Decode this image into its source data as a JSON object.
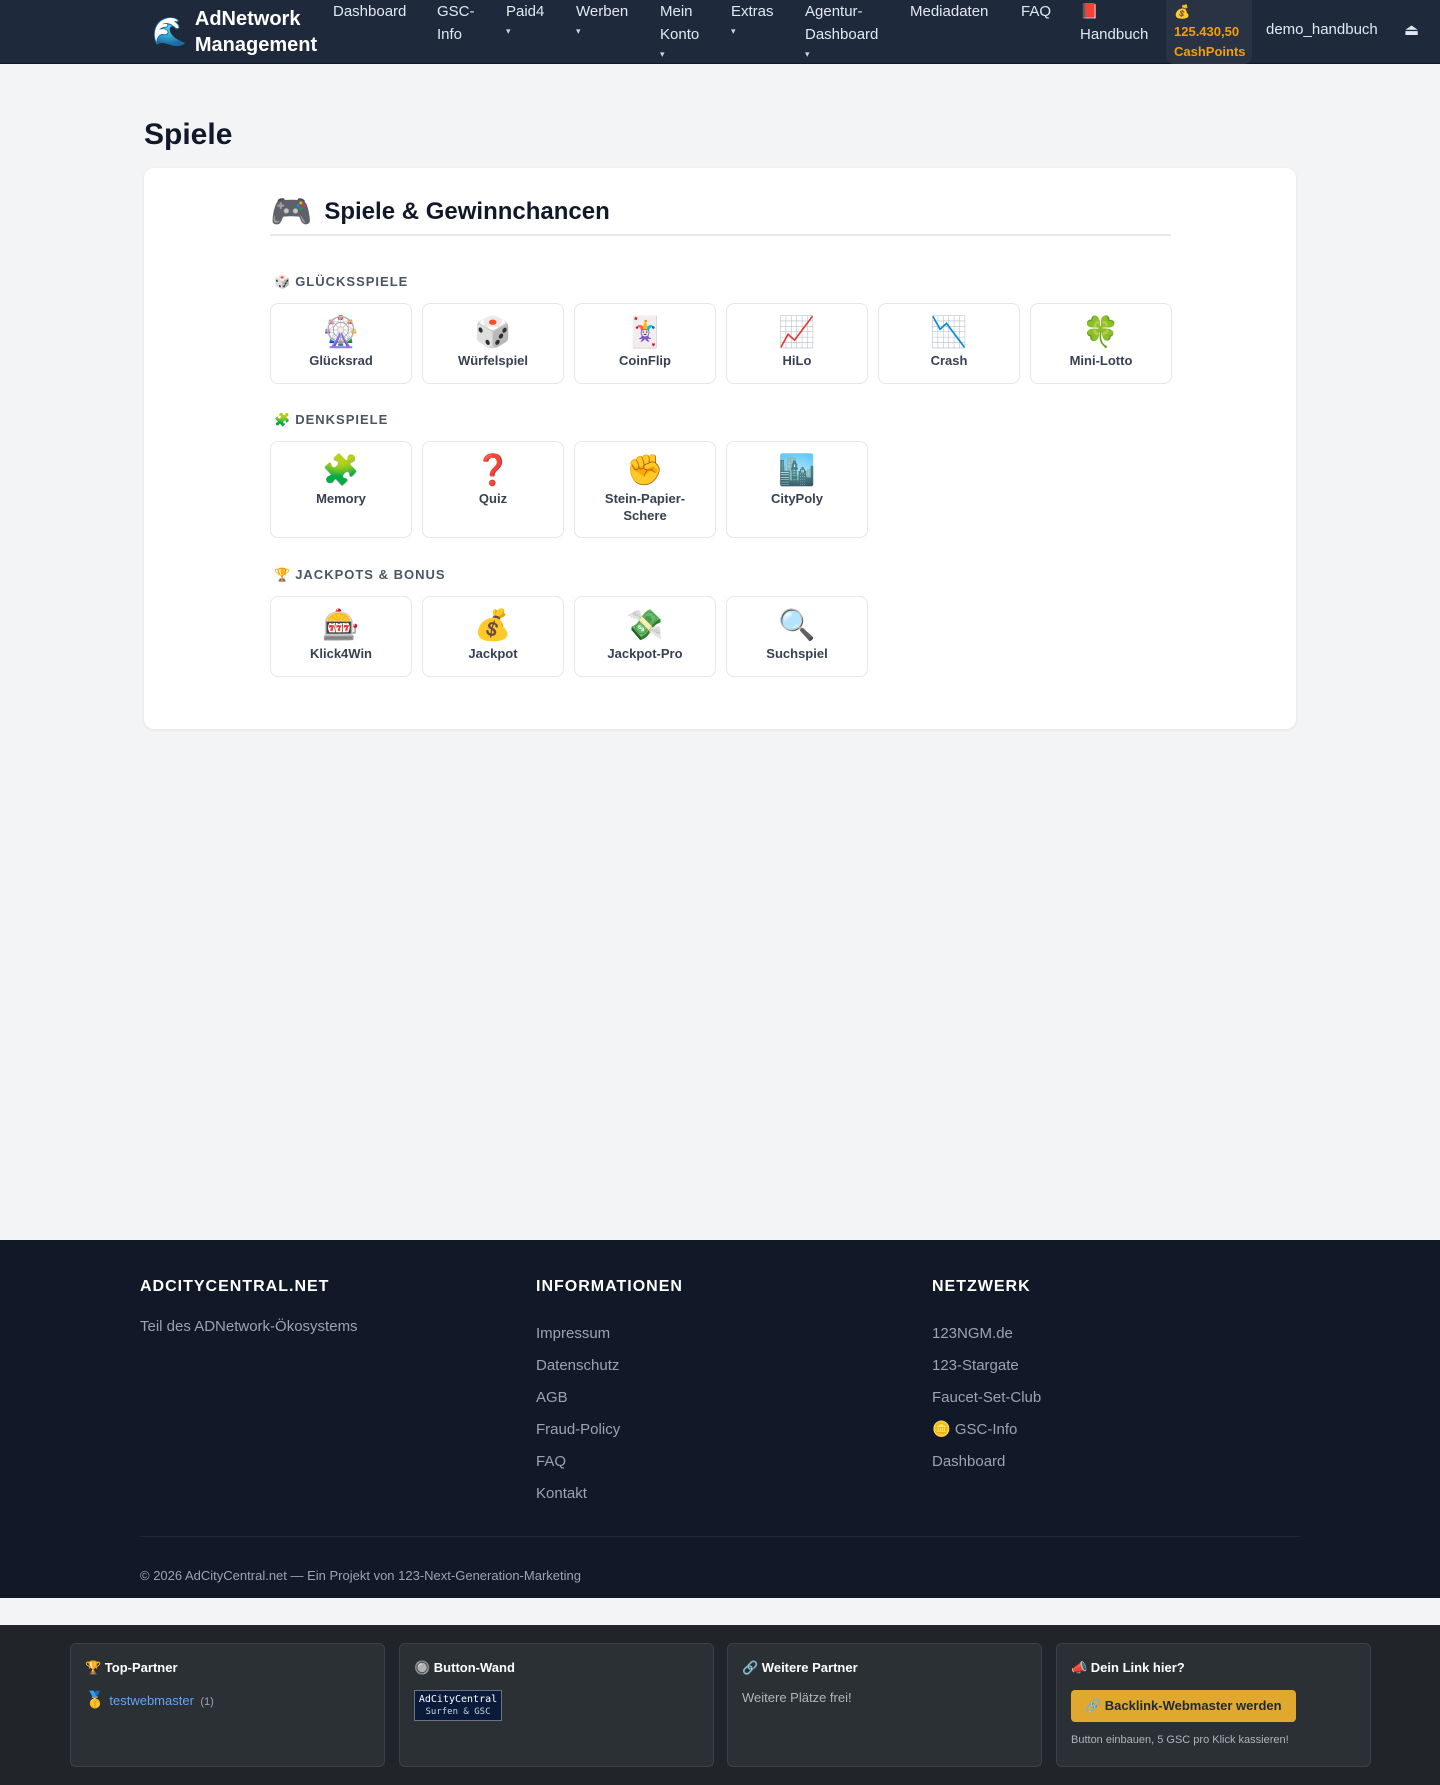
{
  "nav": {
    "brand_icon": "🌊",
    "brand": "AdNetwork Management",
    "items": [
      {
        "label": "Dashboard",
        "caret": ""
      },
      {
        "label": "GSC-Info",
        "caret": ""
      },
      {
        "label": "Paid4",
        "caret": "▾"
      },
      {
        "label": "Werben",
        "caret": "▾"
      },
      {
        "label": "Mein Konto",
        "caret": "▾"
      },
      {
        "label": "Extras",
        "caret": "▾"
      },
      {
        "label": "Agentur-Dashboard",
        "caret": "▾"
      },
      {
        "label": "Mediadaten",
        "caret": ""
      },
      {
        "label": "FAQ",
        "caret": ""
      }
    ],
    "handbook_icon": "📕",
    "handbook_label": "Handbuch",
    "points_icon": "💰",
    "points_value": "125.430,50",
    "points_unit": "CashPoints",
    "username": "demo_handbuch",
    "logout_icon": "⏏"
  },
  "page": {
    "title": "Spiele",
    "card_icon": "🎮",
    "card_title": "Spiele & Gewinnchancen"
  },
  "sections": [
    {
      "icon": "🎲",
      "title": "GLÜCKSSPIELE",
      "games": [
        {
          "icon": "🎡",
          "label": "Glücksrad"
        },
        {
          "icon": "🎲",
          "label": "Würfelspiel"
        },
        {
          "icon": "🃏",
          "label": "CoinFlip"
        },
        {
          "icon": "📈",
          "label": "HiLo"
        },
        {
          "icon": "📉",
          "label": "Crash"
        },
        {
          "icon": "🍀",
          "label": "Mini-Lotto"
        }
      ]
    },
    {
      "icon": "🧩",
      "title": "DENKSPIELE",
      "games": [
        {
          "icon": "🧩",
          "label": "Memory"
        },
        {
          "icon": "❓",
          "label": "Quiz"
        },
        {
          "icon": "✊",
          "label": "Stein-Papier-Schere"
        },
        {
          "icon": "🏙️",
          "label": "CityPoly"
        }
      ]
    },
    {
      "icon": "🏆",
      "title": "JACKPOTS & BONUS",
      "games": [
        {
          "icon": "🎰",
          "label": "Klick4Win"
        },
        {
          "icon": "💰",
          "label": "Jackpot"
        },
        {
          "icon": "💸",
          "label": "Jackpot-Pro"
        },
        {
          "icon": "🔍",
          "label": "Suchspiel"
        }
      ]
    }
  ],
  "footer": {
    "col1": {
      "title": "ADCITYCENTRAL.NET",
      "tagline": "Teil des ADNetwork-Ökosystems"
    },
    "col2": {
      "title": "INFORMATIONEN",
      "links": [
        "Impressum",
        "Datenschutz",
        "AGB",
        "Fraud-Policy",
        "FAQ",
        "Kontakt"
      ]
    },
    "col3": {
      "title": "NETZWERK",
      "links": [
        "123NGM.de",
        "123-Stargate",
        "Faucet-Set-Club",
        "🪙 GSC-Info",
        "Dashboard"
      ]
    },
    "copyright": "© 2026 AdCityCentral.net — Ein Projekt von 123-Next-Generation-Marketing"
  },
  "partners": {
    "top": {
      "title": "🏆 Top-Partner",
      "medal": "🥇",
      "name": "testwebmaster",
      "count": "(1)"
    },
    "wall": {
      "title": "🔘 Button-Wand",
      "banner_line1": "AdCityCentral",
      "banner_line2": "Surfen & GSC"
    },
    "more": {
      "title": "🔗 Weitere Partner",
      "text": "Weitere Plätze frei!"
    },
    "yours": {
      "title": "📣 Dein Link hier?",
      "button": "🔗 Backlink-Webmaster werden",
      "note": "Button einbauen, 5 GSC pro Klick kassieren!"
    }
  }
}
